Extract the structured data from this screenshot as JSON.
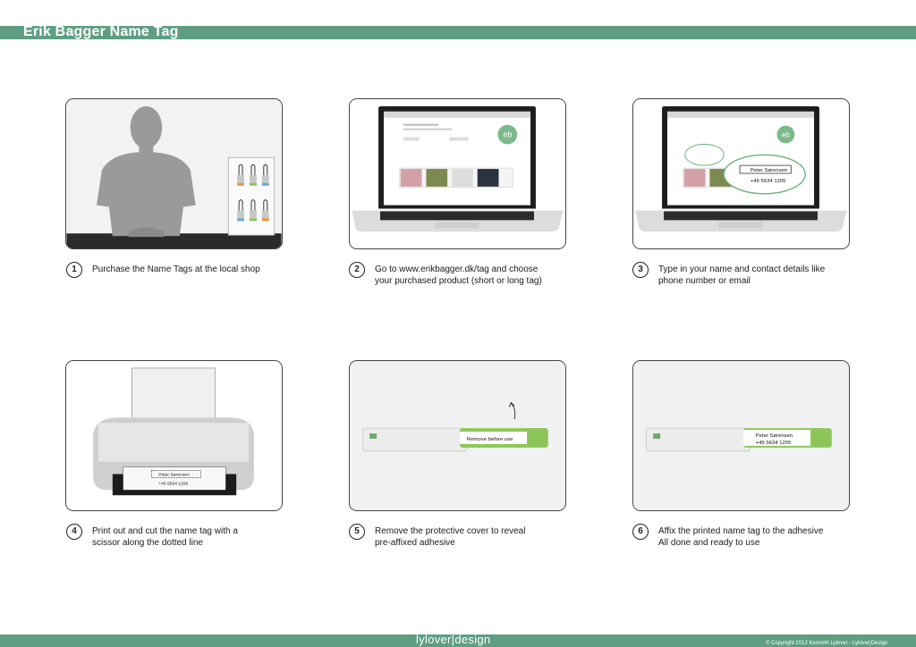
{
  "header": {
    "title": "Erik Bagger Name Tag"
  },
  "steps": [
    {
      "number": "1",
      "text": "Purchase the Name Tags at the local shop"
    },
    {
      "number": "2",
      "line1": "Go to www.erikbagger.dk/tag and choose",
      "line2": "your purchased product (short or long tag)"
    },
    {
      "number": "3",
      "line1": "Type in your name and contact details like",
      "line2": "phone number or email"
    },
    {
      "number": "4",
      "line1": "Print out and cut the name tag with a",
      "line2": "scissor along the dotted line"
    },
    {
      "number": "5",
      "line1": "Remove the protective cover to reveal",
      "line2": "pre-affixed adhesive"
    },
    {
      "number": "6",
      "line1": "Affix the printed name tag to the adhesive",
      "line2": "All done and ready to use"
    }
  ],
  "illustrations": {
    "tag_name": "Peter Sørensen",
    "tag_phone": "+45 5634 1205",
    "cover_label": "Remove before use",
    "logo": "eb"
  },
  "footer": {
    "brand": "lylover|design",
    "copyright": "© Copyright 2012 Kenneth Lylover - Lylover|Design"
  },
  "colors": {
    "accent_green": "#5f9e82",
    "tag_green": "#8cc65a"
  }
}
